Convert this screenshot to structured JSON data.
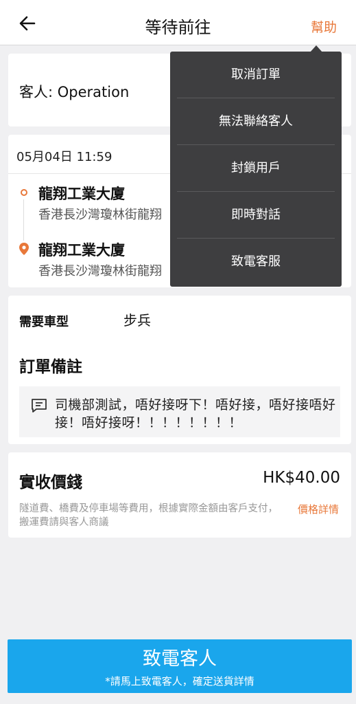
{
  "header": {
    "title": "等待前往",
    "help_label": "幫助"
  },
  "customer": {
    "label": "客人: Operation"
  },
  "trip": {
    "datetime": "05月04日 11:59",
    "pickup": {
      "name": "龍翔工業大廈",
      "address": "香港長沙灣瓊林街龍翔"
    },
    "dropoff": {
      "name": "龍翔工業大廈",
      "address": "香港長沙灣瓊林街龍翔"
    }
  },
  "order": {
    "vehicle_type_label": "需要車型",
    "vehicle_type_value": "步兵",
    "note_title": "訂單備註",
    "note_text": "司機部測試，唔好接呀下！唔好接，唔好接唔好接！唔好接呀！！！！！！！！"
  },
  "price": {
    "label": "實收價錢",
    "value": "HK$40.00",
    "note": "隧道費、橋費及停車場等費用，根據實際金額由客戶支付，搬運費請與客人商議",
    "details_link": "價格詳情"
  },
  "call_button": {
    "label": "致電客人",
    "sublabel": "*請馬上致電客人，確定送貨詳情"
  },
  "menu": {
    "items": [
      "取消訂單",
      "無法聯絡客人",
      "封鎖用戶",
      "即時對話",
      "致電客服"
    ]
  },
  "colors": {
    "accent": "#e8783a",
    "primary_button": "#1aa6ec",
    "menu_bg": "#3e3e40"
  }
}
